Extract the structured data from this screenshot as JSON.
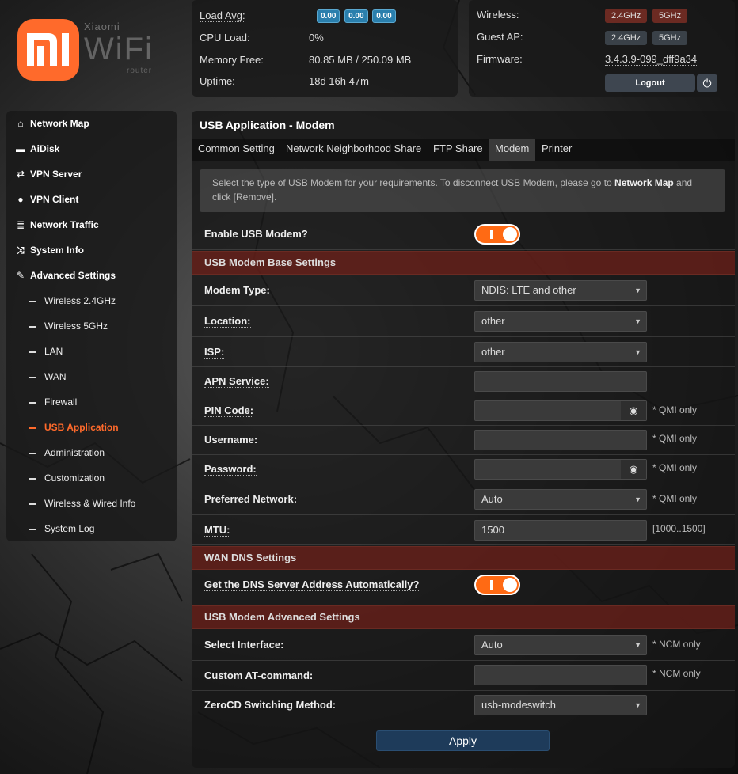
{
  "logo": {
    "small": "Xiaomi",
    "wifi": "WiFi",
    "router": "router"
  },
  "status": {
    "load_avg_label": "Load Avg:",
    "load_avg": [
      "0.00",
      "0.00",
      "0.00"
    ],
    "cpu_label": "CPU Load:",
    "cpu": "0%",
    "mem_label": "Memory Free:",
    "mem": "80.85 MB / 250.09 MB",
    "uptime_label": "Uptime:",
    "uptime": "18d 16h 47m"
  },
  "wifi": {
    "wireless_label": "Wireless:",
    "guest_label": "Guest AP:",
    "firmware_label": "Firmware:",
    "band_24": "2.4GHz",
    "band_5": "5GHz",
    "firmware": "3.4.3.9-099_dff9a34",
    "logout": "Logout"
  },
  "sidebar": {
    "items": [
      {
        "label": "Network Map",
        "icon": "home-icon"
      },
      {
        "label": "AiDisk",
        "icon": "disk-icon"
      },
      {
        "label": "VPN Server",
        "icon": "vpn-server-icon"
      },
      {
        "label": "VPN Client",
        "icon": "globe-icon"
      },
      {
        "label": "Network Traffic",
        "icon": "traffic-icon"
      },
      {
        "label": "System Info",
        "icon": "shuffle-icon"
      },
      {
        "label": "Advanced Settings",
        "icon": "wrench-icon"
      }
    ],
    "sub": [
      "Wireless 2.4GHz",
      "Wireless 5GHz",
      "LAN",
      "WAN",
      "Firewall",
      "USB Application",
      "Administration",
      "Customization",
      "Wireless & Wired Info",
      "System Log"
    ],
    "active": "USB Application"
  },
  "main": {
    "title": "USB Application - Modem",
    "tabs": [
      "Common Setting",
      "Network Neighborhood Share",
      "FTP Share",
      "Modem",
      "Printer"
    ],
    "active_tab": "Modem",
    "info_text": "Select the type of USB Modem for your requirements. To disconnect USB Modem, please go to ",
    "info_bold": "Network Map",
    "info_tail": " and click [Remove].",
    "enable_label": "Enable USB Modem?",
    "enable_value": "I",
    "base_section": "USB Modem Base Settings",
    "modem_type_label": "Modem Type:",
    "modem_type": "NDIS: LTE and other",
    "location_label": "Location:",
    "location": "other",
    "isp_label": "ISP:",
    "isp": "other",
    "apn_label": "APN Service:",
    "pin_label": "PIN Code:",
    "username_label": "Username:",
    "password_label": "Password:",
    "preferred_label": "Preferred Network:",
    "preferred": "Auto",
    "mtu_label": "MTU:",
    "mtu": "1500",
    "mtu_range": "[1000..1500]",
    "qmi_only": "* QMI only",
    "dns_section": "WAN DNS Settings",
    "dns_auto_label": "Get the DNS Server Address Automatically?",
    "adv_section": "USB Modem Advanced Settings",
    "iface_label": "Select Interface:",
    "iface": "Auto",
    "ncm_only": "* NCM only",
    "at_label": "Custom AT-command:",
    "zerocd_label": "ZeroCD Switching Method:",
    "zerocd": "usb-modeswitch",
    "apply": "Apply"
  },
  "colors": {
    "accent": "#ff6a2b",
    "section_bg": "#6e201a",
    "button_blue": "#1e3b5a",
    "badge_blue": "#2a7fad"
  }
}
